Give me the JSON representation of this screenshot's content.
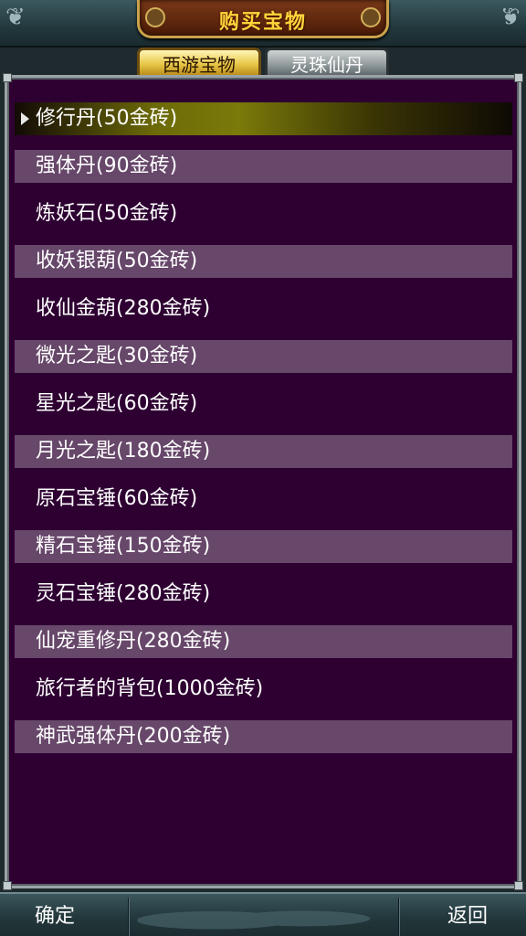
{
  "header": {
    "title": "购买宝物"
  },
  "tabs": [
    {
      "label": "西游宝物",
      "active": true
    },
    {
      "label": "灵珠仙丹",
      "active": false
    }
  ],
  "items": [
    {
      "label": "修行丹(50金砖)",
      "selected": true
    },
    {
      "label": "强体丹(90金砖)"
    },
    {
      "label": "炼妖石(50金砖)"
    },
    {
      "label": "收妖银葫(50金砖)"
    },
    {
      "label": "收仙金葫(280金砖)"
    },
    {
      "label": "微光之匙(30金砖)"
    },
    {
      "label": "星光之匙(60金砖)"
    },
    {
      "label": "月光之匙(180金砖)"
    },
    {
      "label": "原石宝锤(60金砖)"
    },
    {
      "label": "精石宝锤(150金砖)"
    },
    {
      "label": "灵石宝锤(280金砖)"
    },
    {
      "label": "仙宠重修丹(280金砖)"
    },
    {
      "label": "旅行者的背包(1000金砖)"
    },
    {
      "label": "神武强体丹(200金砖)"
    }
  ],
  "footer": {
    "confirm_label": "确定",
    "back_label": "返回"
  },
  "colors": {
    "panel_bg": "#2e0032",
    "row_shade": "#67476a",
    "title_text": "#ffd53a",
    "selected_highlight": "#7a7a0a"
  }
}
